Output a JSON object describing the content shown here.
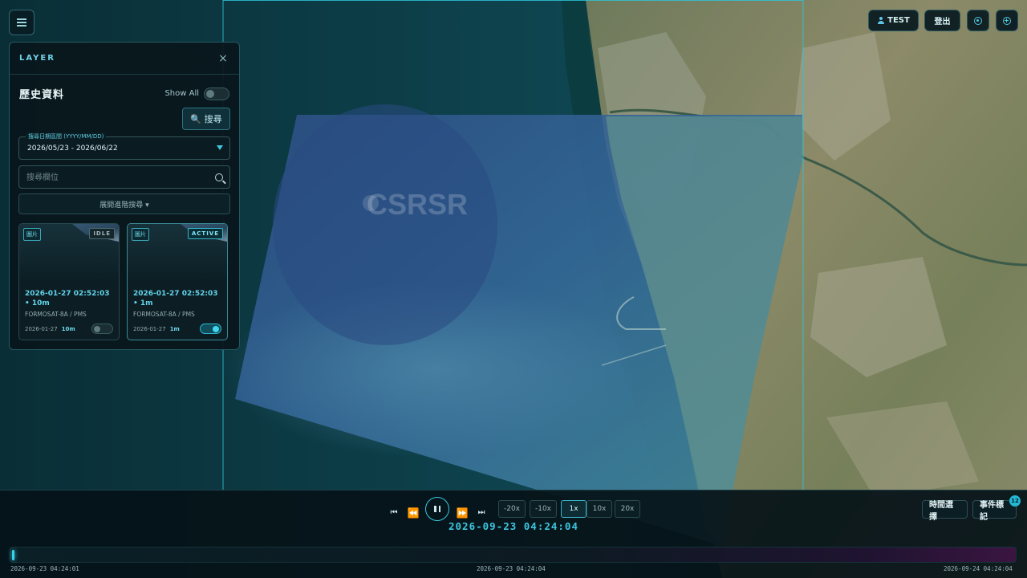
{
  "map": {
    "watermark": "CSRSR"
  },
  "menu": {
    "icon": "hamburger-icon"
  },
  "layer_panel": {
    "title": "LAYER",
    "close_label": "×",
    "section_title": "歷史資料",
    "show_all_label": "Show All",
    "show_all_on": false,
    "search_button": "🔍 搜尋",
    "date_range": {
      "label": "搜尋日期區間 (YYYY/MM/DD)",
      "value": "2026/05/23 - 2026/06/22"
    },
    "location_search": {
      "placeholder": "搜尋欄位",
      "value": ""
    },
    "advanced_search_label": "展開進階搜尋 ▾",
    "cards": [
      {
        "type_tag": "圖片",
        "status": "IDLE",
        "datetime": "2026-01-27 02:52:03 • 10m",
        "sensor": "FORMOSAT-8A / PMS",
        "foot_date": "2026-01-27",
        "foot_res": "10m",
        "enabled": false
      },
      {
        "type_tag": "圖片",
        "status": "ACTIVE",
        "datetime": "2026-01-27 02:52:03 • 1m",
        "sensor": "FORMOSAT-8A / PMS",
        "foot_date": "2026-01-27",
        "foot_res": "1m",
        "enabled": true
      }
    ]
  },
  "top_right": {
    "user_label": "TEST",
    "logout_label": "登出",
    "icons": [
      "user-icon",
      "target-icon",
      "zoom-plus-icon"
    ]
  },
  "timeline": {
    "controls": {
      "skip_start": "⏮",
      "rewind": "⏪",
      "fast_forward": "⏩",
      "skip_end": "⏭"
    },
    "speeds": [
      "-20x",
      "-10x",
      "1x",
      "10x",
      "20x"
    ],
    "selected_speed": "1x",
    "current_time": "2026-09-23 04:24:04",
    "time_select_label": "時間選擇",
    "event_mark_label": "事件標記",
    "event_count": "12",
    "scale_labels": {
      "start": "2026-09-23 04:24:01",
      "middle": "2026-09-23 04:24:04",
      "end": "2026-09-24 04:24:04"
    },
    "progress": 0.002
  },
  "colors": {
    "accent": "#3ec5dd",
    "panel_bg": "#08161c",
    "orange_control": "#f0a23a"
  }
}
